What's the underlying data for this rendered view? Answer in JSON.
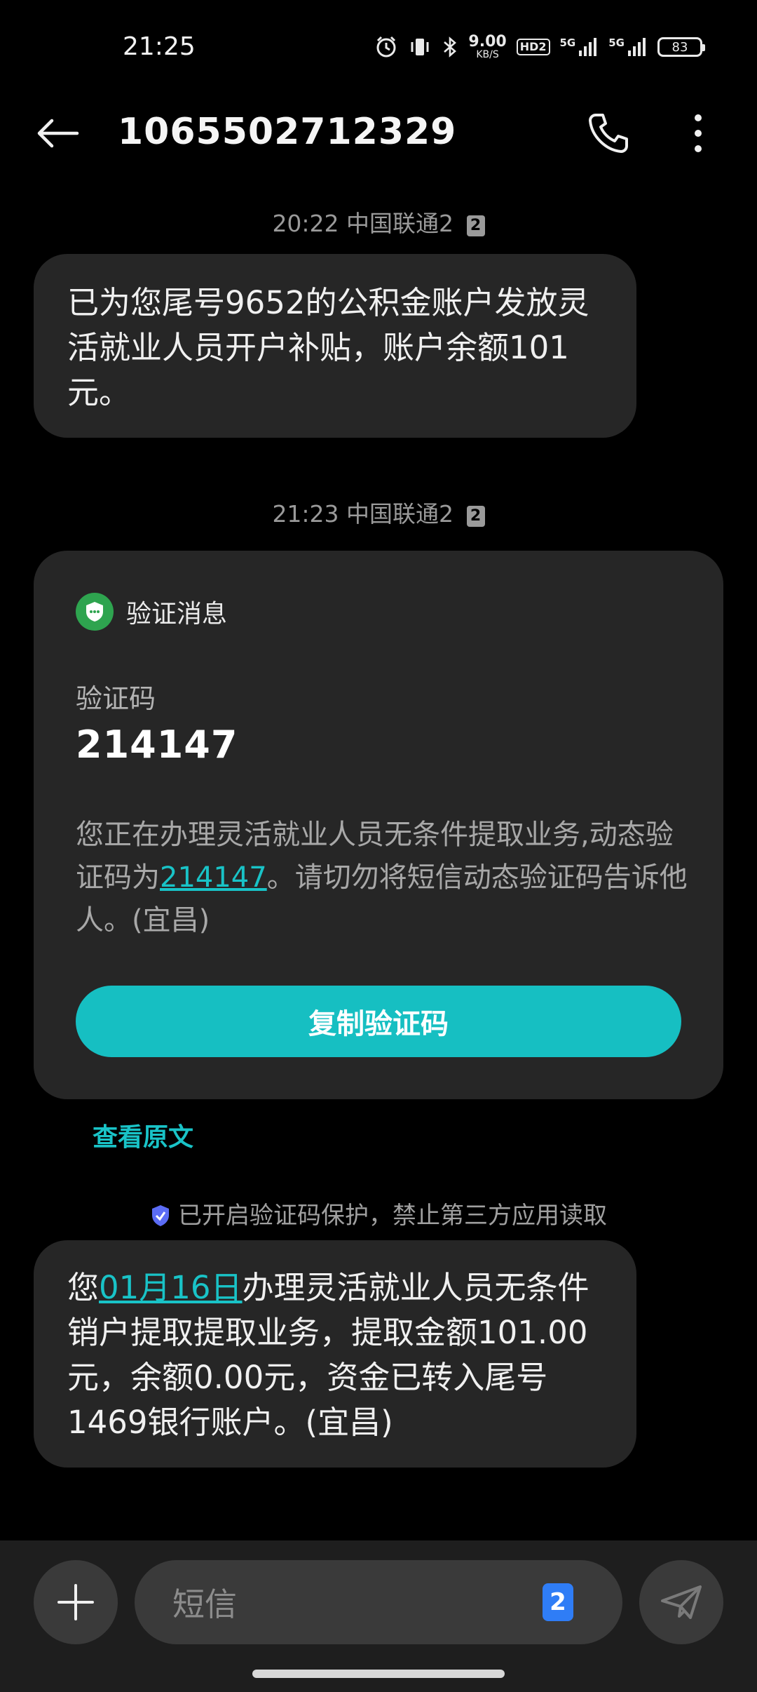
{
  "status_bar": {
    "time": "21:25",
    "net_speed_value": "9.00",
    "net_speed_unit": "KB/S",
    "hd_label": "HD2",
    "signal_1": "5G",
    "signal_2": "5G",
    "battery": "83",
    "icons": [
      "alarm-icon",
      "vibrate-icon",
      "bluetooth-icon",
      "signal-icon",
      "battery-icon"
    ]
  },
  "header": {
    "contact": "1065502712329",
    "icons": [
      "back-arrow-icon",
      "phone-icon",
      "more-vert-icon"
    ]
  },
  "messages": {
    "ts1_time": "20:22",
    "ts1_carrier": "中国联通2",
    "ts1_sim": "2",
    "msg1": "已为您尾号9652的公积金账户发放灵活就业人员开户补贴，账户余额101元。",
    "ts2_time": "21:23",
    "ts2_carrier": "中国联通2",
    "ts2_sim": "2",
    "card": {
      "title": "验证消息",
      "code_label": "验证码",
      "code": "214147",
      "body_before": "您正在办理灵活就业人员无条件提取业务,动态验证码为",
      "body_code": "214147",
      "body_after": "。请切勿将短信动态验证码告诉他人。(宜昌)",
      "copy_button": "复制验证码"
    },
    "view_original": "查看原文",
    "protect_note": "已开启验证码保护，禁止第三方应用读取",
    "msg3_before": "您",
    "msg3_date": "01月16日",
    "msg3_after": "办理灵活就业人员无条件销户提取提取业务，提取金额101.00元，余额0.00元，资金已转入尾号1469银行账户。(宜昌)"
  },
  "composer": {
    "placeholder": "短信",
    "sim": "2"
  },
  "colors": {
    "accent": "#16bfc2",
    "bubble": "#262626",
    "background": "#000000",
    "sim_badge": "#2f7df6",
    "shield_green": "#2ea44f"
  }
}
